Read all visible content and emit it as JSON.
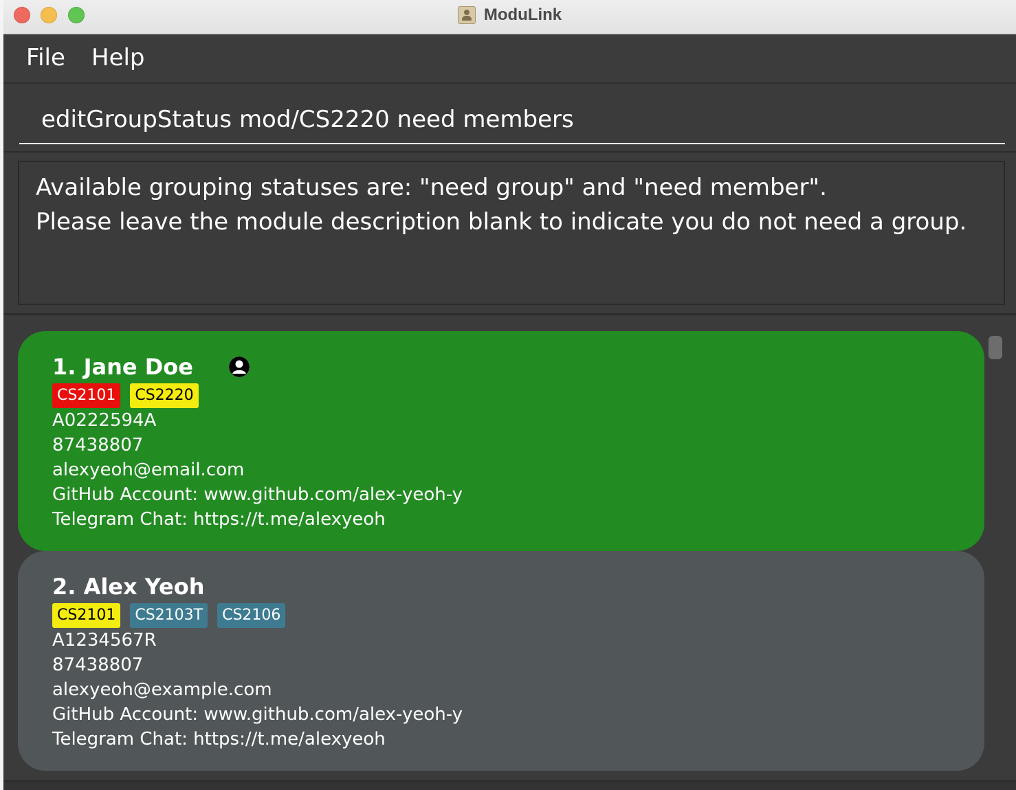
{
  "window": {
    "title": "ModuLink"
  },
  "menu": {
    "items": [
      {
        "label": "File"
      },
      {
        "label": "Help"
      }
    ]
  },
  "command": {
    "value": "editGroupStatus mod/CS2220 need members"
  },
  "result": {
    "lines": [
      "Available grouping statuses are: \"need group\" and \"need member\".",
      "Please leave the module description blank to indicate you do not need a group."
    ]
  },
  "persons": [
    {
      "name": "1. Jane Doe",
      "has_person_icon": true,
      "card_color": "#228b22",
      "tags": [
        {
          "label": "CS2101",
          "color": "red"
        },
        {
          "label": "CS2220",
          "color": "yellow"
        }
      ],
      "student_id": "A0222594A",
      "phone": "87438807",
      "email": "alexyeoh@email.com",
      "github": "GitHub Account: www.github.com/alex-yeoh-y",
      "telegram": "Telegram Chat: https://t.me/alexyeoh"
    },
    {
      "name": "2. Alex Yeoh",
      "has_person_icon": false,
      "card_color": "#515658",
      "tags": [
        {
          "label": "CS2101",
          "color": "yellow"
        },
        {
          "label": "CS2103T",
          "color": "blue"
        },
        {
          "label": "CS2106",
          "color": "blue"
        }
      ],
      "student_id": "A1234567R",
      "phone": "87438807",
      "email": "alexyeoh@example.com",
      "github": "GitHub Account: www.github.com/alex-yeoh-y",
      "telegram": "Telegram Chat: https://t.me/alexyeoh"
    }
  ],
  "colors": {
    "tag_red": "#e8100c",
    "tag_yellow": "#f4eb0f",
    "tag_blue": "#3e7b91"
  }
}
